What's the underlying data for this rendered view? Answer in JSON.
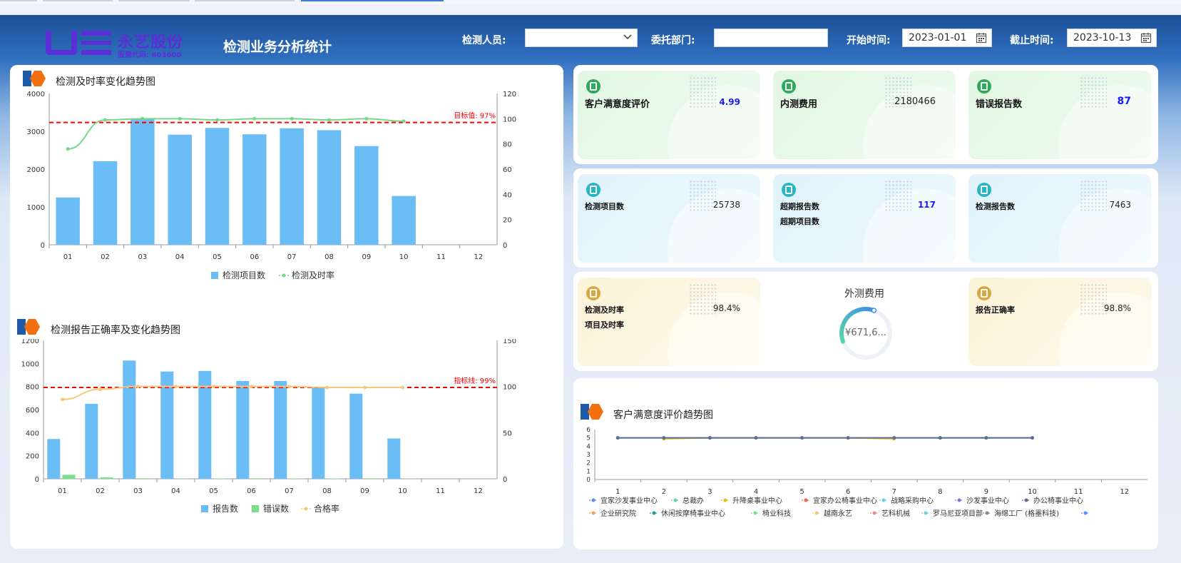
{
  "header": {
    "logo_name": "永艺股份",
    "logo_code": "股票代码: 603600",
    "title": "检测业务分析统计"
  },
  "filters": {
    "inspector_label": "检测人员:",
    "inspector_value": "",
    "dept_label": "委托部门:",
    "dept_value": "",
    "start_label": "开始时间:",
    "start_value": "2023-01-01",
    "end_label": "截止时间:",
    "end_value": "2023-10-13"
  },
  "kpi": {
    "satisfaction_label": "客户满意度评价",
    "satisfaction_value": "4.99",
    "internal_cost_label": "内测费用",
    "internal_cost_value": "2180466",
    "error_reports_label": "错误报告数",
    "error_reports_value": "87",
    "items_label": "检测项目数",
    "items_value": "25738",
    "overdue_reports_label": "超期报告数",
    "overdue_reports_value": "117",
    "overdue_items_label": "超期项目数",
    "reports_label": "检测报告数",
    "reports_value": "7463",
    "timely_label": "检测及时率",
    "timely_value": "98.4%",
    "item_timely_label": "项目及时率",
    "external_cost_label": "外测费用",
    "external_cost_value": "¥671,6...",
    "external_cost_fraction": 0.36,
    "accuracy_label": "报告正确率",
    "accuracy_value": "98.8%"
  },
  "colors": {
    "bar": "#6bbdf5",
    "timely_line": "#79d68a",
    "target": "#ff0000",
    "error_bar": "#7be08a",
    "pass_line": "#f7c77a"
  },
  "chart_data": [
    {
      "type": "bar",
      "title": "检测及时率变化趋势图",
      "categories": [
        "01",
        "02",
        "03",
        "04",
        "05",
        "06",
        "07",
        "08",
        "09",
        "10",
        "11",
        "12"
      ],
      "ylim": [
        0,
        4000
      ],
      "y2lim": [
        0,
        120
      ],
      "yticks": [
        "0",
        "1000",
        "2000",
        "3000",
        "4000"
      ],
      "y2ticks": [
        "0",
        "20",
        "40",
        "60",
        "80",
        "100",
        "120"
      ],
      "series": [
        {
          "name": "检测项目数",
          "axis": "left",
          "values": [
            1250,
            2210,
            3340,
            2910,
            3090,
            2920,
            3080,
            3030,
            2610,
            1290,
            null,
            null
          ]
        },
        {
          "name": "检测及时率",
          "axis": "right",
          "type": "line",
          "values": [
            76,
            99,
            100,
            100,
            99,
            100,
            100,
            99,
            100,
            98,
            null,
            null
          ]
        }
      ],
      "target": {
        "value": 97,
        "label": "目标值: 97%"
      }
    },
    {
      "type": "bar",
      "title": "检测报告正确率及变化趋势图",
      "categories": [
        "01",
        "02",
        "03",
        "04",
        "05",
        "06",
        "07",
        "08",
        "09",
        "10",
        "11",
        "12"
      ],
      "ylim": [
        0,
        1200
      ],
      "y2lim": [
        0,
        150
      ],
      "yticks": [
        "0",
        "200",
        "400",
        "600",
        "800",
        "1000",
        "1200"
      ],
      "y2ticks": [
        "0",
        "50",
        "100",
        "150"
      ],
      "series": [
        {
          "name": "报告数",
          "axis": "left",
          "values": [
            345,
            650,
            1025,
            930,
            935,
            848,
            848,
            790,
            738,
            350,
            null,
            null
          ]
        },
        {
          "name": "错误数",
          "axis": "left",
          "values": [
            35,
            12,
            5,
            2,
            3,
            4,
            3,
            3,
            4,
            2,
            null,
            null
          ]
        },
        {
          "name": "合格率",
          "axis": "right",
          "type": "line",
          "values": [
            86,
            97,
            100,
            100,
            100,
            100,
            100,
            99,
            99,
            99,
            null,
            null
          ]
        }
      ],
      "target": {
        "value": 99,
        "label": "指标线: 99%"
      }
    },
    {
      "type": "line",
      "title": "客户满意度评价趋势图",
      "categories": [
        "1",
        "2",
        "3",
        "4",
        "5",
        "6",
        "7",
        "8",
        "9",
        "10",
        "11",
        "12"
      ],
      "ylim": [
        0,
        6
      ],
      "yticks": [
        "0",
        "1",
        "2",
        "3",
        "4",
        "5",
        "6"
      ],
      "series": [
        {
          "name": "宜家沙发事业中心",
          "color": "#5b8ff9",
          "values": [
            5,
            5,
            5,
            5,
            5,
            5,
            5,
            5,
            5,
            5,
            null,
            null
          ]
        },
        {
          "name": "总裁办",
          "color": "#5ad8a6",
          "values": [
            null,
            null,
            null,
            null,
            null,
            null,
            null,
            null,
            null,
            null,
            null,
            null
          ]
        },
        {
          "name": "升降桌事业中心",
          "color": "#f6bd16",
          "values": [
            null,
            4.9,
            5,
            5,
            null,
            5,
            4.9,
            null,
            null,
            null,
            null,
            null
          ]
        },
        {
          "name": "宜家办公椅事业中心",
          "color": "#e8684a",
          "values": [
            null,
            null,
            null,
            null,
            null,
            null,
            null,
            null,
            null,
            null,
            null,
            null
          ]
        },
        {
          "name": "战略采购中心",
          "color": "#6dc8ec",
          "values": [
            null,
            null,
            5,
            null,
            null,
            null,
            null,
            null,
            null,
            null,
            null,
            null
          ]
        },
        {
          "name": "沙发事业中心",
          "color": "#9270ca",
          "values": [
            null,
            null,
            null,
            null,
            null,
            null,
            null,
            null,
            null,
            null,
            null,
            null
          ]
        },
        {
          "name": "办公椅事业中心",
          "color": "#5d7092",
          "values": [
            5,
            5,
            5,
            5,
            5,
            5,
            5,
            5,
            5,
            5,
            null,
            null
          ]
        },
        {
          "name": "企业研究院",
          "color": "#ff9d4d",
          "values": [
            null,
            null,
            null,
            null,
            null,
            null,
            null,
            null,
            null,
            null,
            null,
            null
          ]
        },
        {
          "name": "休闲按摩椅事业中心",
          "color": "#269a99",
          "values": [
            null,
            null,
            null,
            null,
            null,
            null,
            null,
            null,
            null,
            null,
            null,
            null
          ]
        },
        {
          "name": "椅业科技",
          "color": "#7be08a",
          "values": [
            null,
            null,
            null,
            null,
            null,
            null,
            null,
            null,
            null,
            null,
            null,
            null
          ]
        },
        {
          "name": "越南永艺",
          "color": "#f7c77a",
          "values": [
            null,
            null,
            null,
            null,
            null,
            null,
            null,
            null,
            null,
            null,
            null,
            null
          ]
        },
        {
          "name": "艺科机械",
          "color": "#f08a8a",
          "values": [
            null,
            null,
            null,
            null,
            null,
            null,
            null,
            null,
            null,
            null,
            null,
            null
          ]
        },
        {
          "name": "罗马尼亚项目部",
          "color": "#6ccfd2",
          "values": [
            null,
            null,
            null,
            null,
            null,
            null,
            null,
            null,
            null,
            null,
            null,
            null
          ]
        },
        {
          "name": "海绵工厂 (格墨科技)",
          "color": "#888a99",
          "values": [
            null,
            null,
            null,
            null,
            null,
            null,
            null,
            null,
            null,
            null,
            null,
            null
          ]
        },
        {
          "name": "",
          "color": "#5b8ff9",
          "values": [
            null,
            null,
            null,
            null,
            null,
            null,
            null,
            null,
            null,
            null,
            null,
            null
          ]
        }
      ]
    }
  ]
}
